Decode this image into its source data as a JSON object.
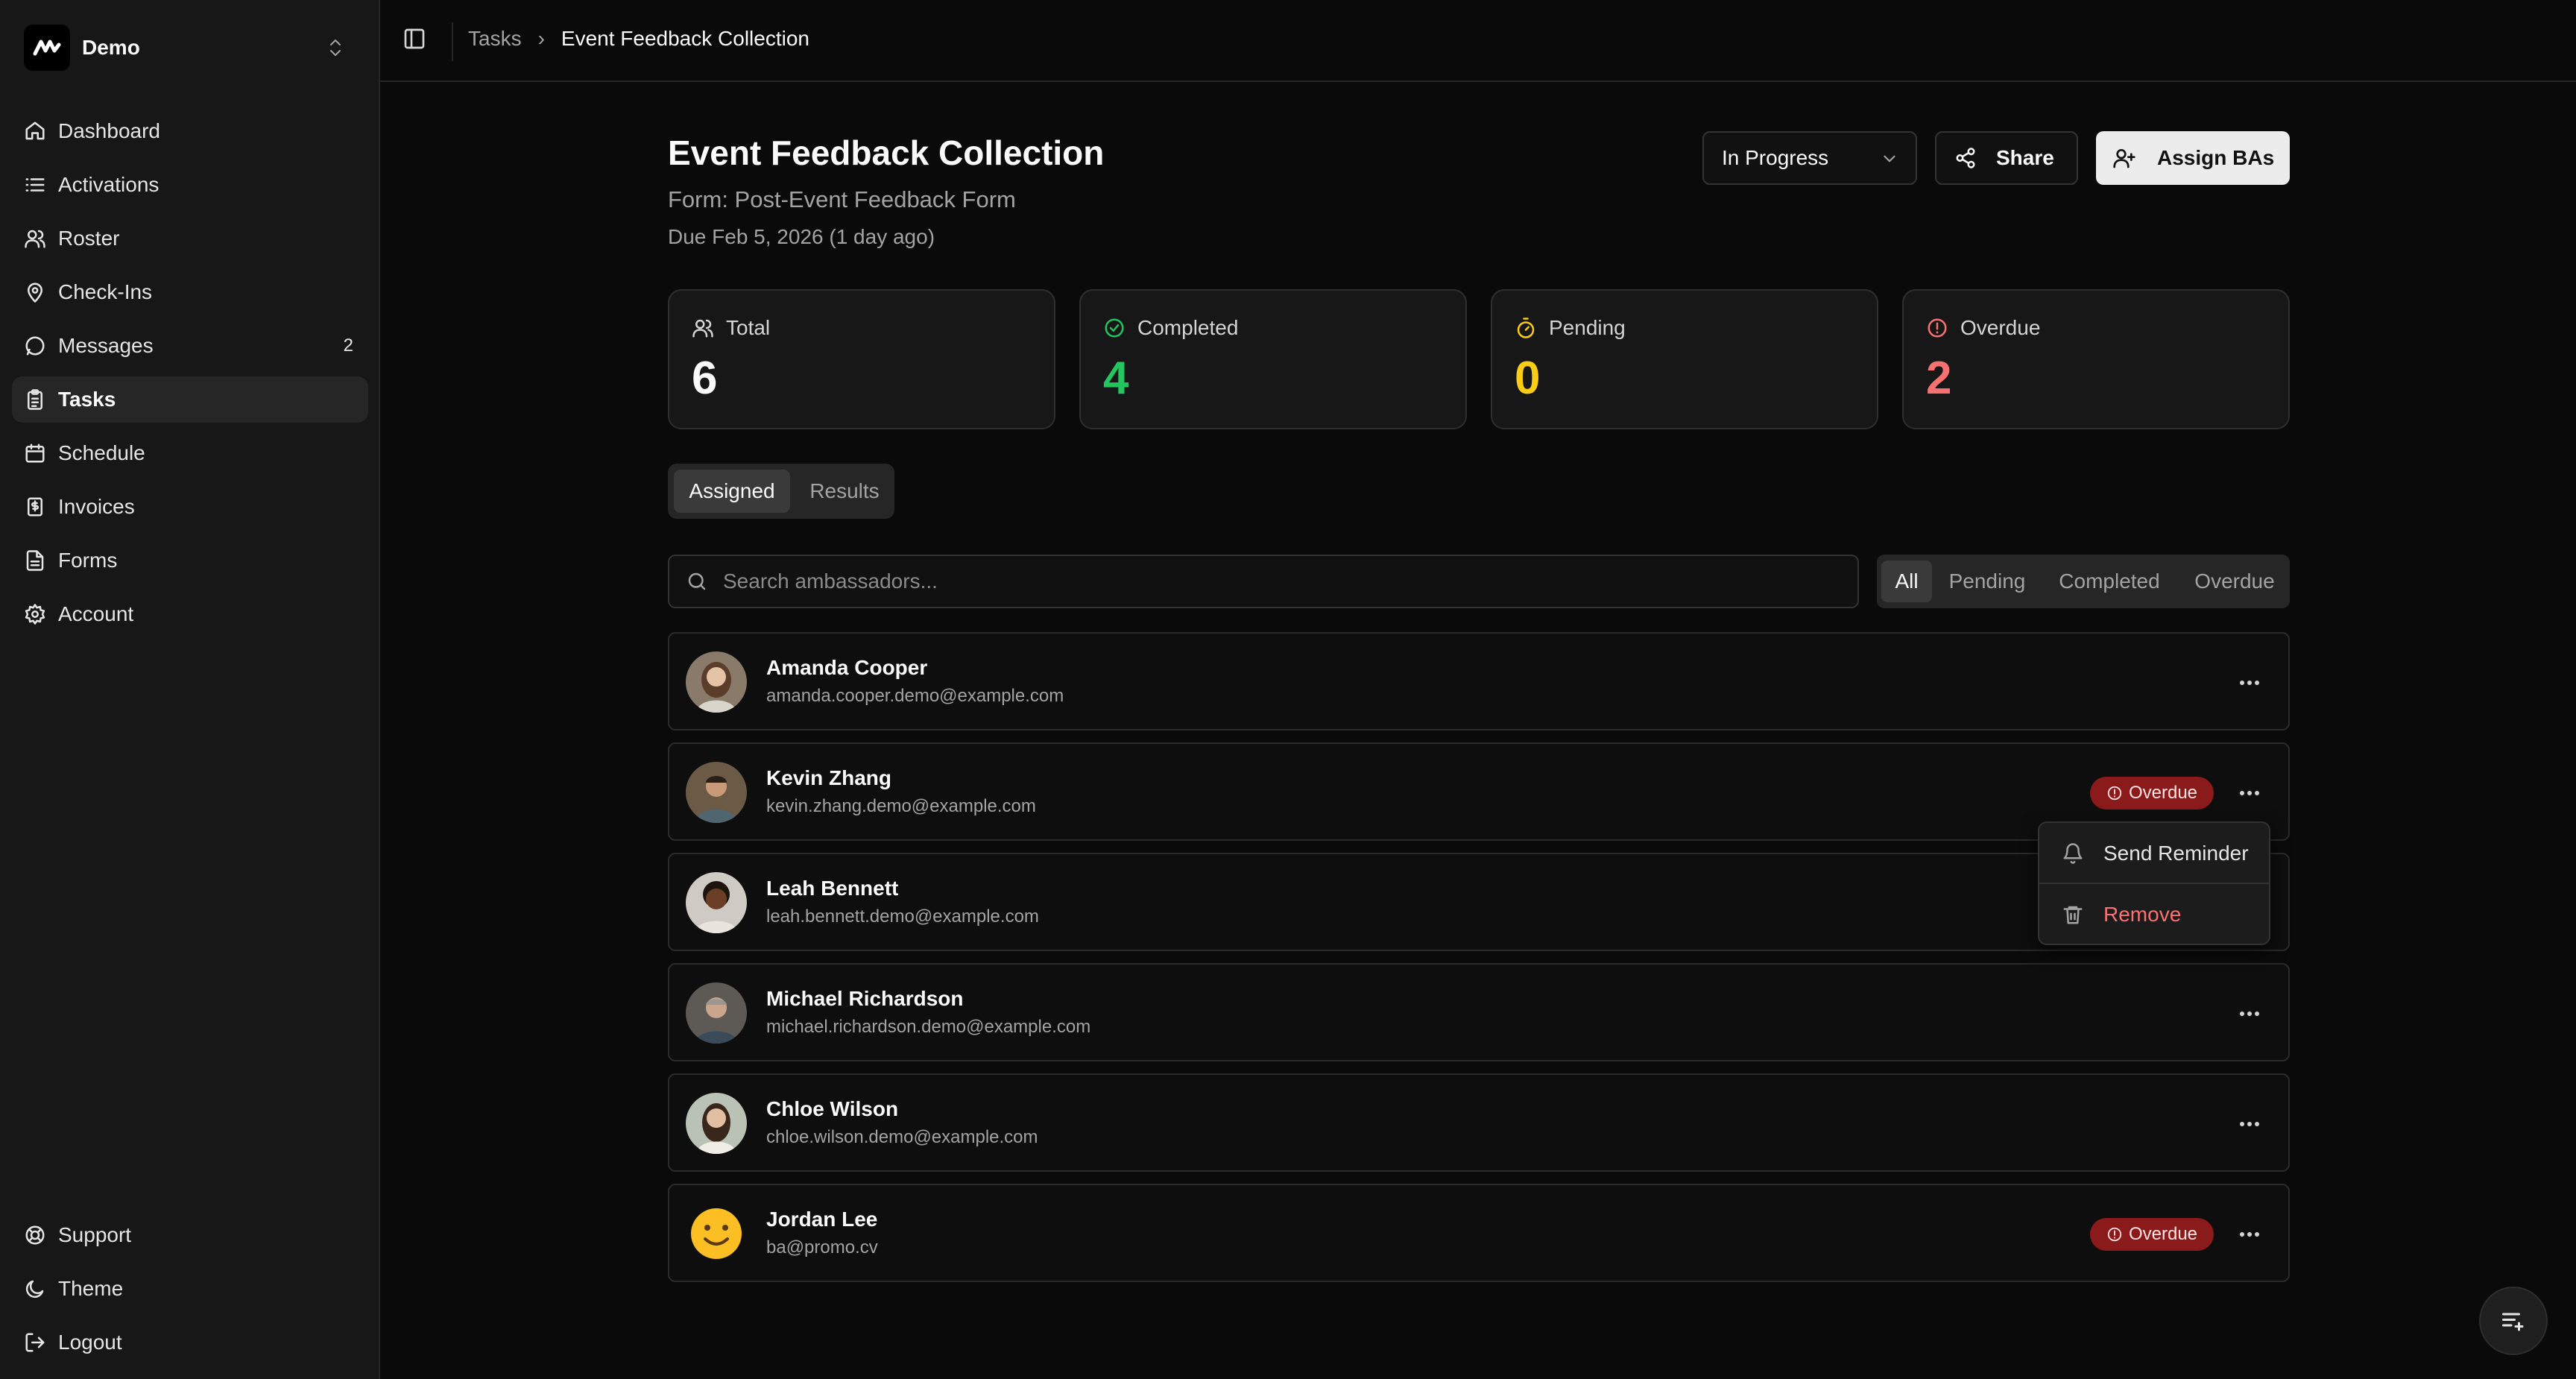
{
  "workspace": {
    "name": "Demo"
  },
  "nav": {
    "items": [
      {
        "label": "Dashboard"
      },
      {
        "label": "Activations"
      },
      {
        "label": "Roster"
      },
      {
        "label": "Check-Ins"
      },
      {
        "label": "Messages",
        "count": "2"
      },
      {
        "label": "Tasks",
        "active": true
      },
      {
        "label": "Schedule"
      },
      {
        "label": "Invoices"
      },
      {
        "label": "Forms"
      },
      {
        "label": "Account"
      }
    ],
    "bottom": [
      {
        "label": "Support"
      },
      {
        "label": "Theme"
      },
      {
        "label": "Logout"
      }
    ]
  },
  "breadcrumb": {
    "parent": "Tasks",
    "separator": "›",
    "current": "Event Feedback Collection"
  },
  "header": {
    "title": "Event Feedback Collection",
    "subtitle": "Form: Post-Event Feedback Form",
    "due": "Due Feb 5, 2026 (1 day ago)",
    "status_value": "In Progress",
    "share_label": "Share",
    "assign_label": "Assign BAs"
  },
  "stats": [
    {
      "label": "Total",
      "value": "6",
      "color": "#fafafa",
      "icon": "users-icon"
    },
    {
      "label": "Completed",
      "value": "4",
      "color": "#22c55e",
      "icon": "check-circle-icon"
    },
    {
      "label": "Pending",
      "value": "0",
      "color": "#facc15",
      "icon": "timer-icon"
    },
    {
      "label": "Overdue",
      "value": "2",
      "color": "#f87171",
      "icon": "alert-circle-icon"
    }
  ],
  "tabs": {
    "assigned": "Assigned",
    "results": "Results"
  },
  "search": {
    "placeholder": "Search ambassadors..."
  },
  "filters": [
    "All",
    "Pending",
    "Completed",
    "Overdue"
  ],
  "ambassadors": [
    {
      "name": "Amanda Cooper",
      "email": "amanda.cooper.demo@example.com",
      "badge": ""
    },
    {
      "name": "Kevin Zhang",
      "email": "kevin.zhang.demo@example.com",
      "badge": "Overdue"
    },
    {
      "name": "Leah Bennett",
      "email": "leah.bennett.demo@example.com",
      "badge": ""
    },
    {
      "name": "Michael Richardson",
      "email": "michael.richardson.demo@example.com",
      "badge": ""
    },
    {
      "name": "Chloe Wilson",
      "email": "chloe.wilson.demo@example.com",
      "badge": ""
    },
    {
      "name": "Jordan Lee",
      "email": "ba@promo.cv",
      "badge": "Overdue"
    }
  ],
  "row_menu": {
    "send_reminder": "Send Reminder",
    "remove": "Remove"
  },
  "colors": {
    "accent_danger": "#f87171",
    "badge_bg": "#8b1a1a",
    "success": "#22c55e",
    "warning": "#facc15"
  }
}
